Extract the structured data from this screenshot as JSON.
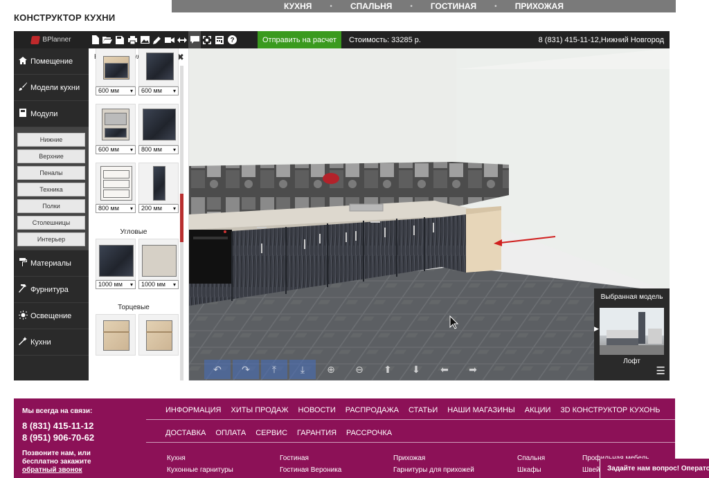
{
  "topnav": {
    "items": [
      "КУХНЯ",
      "СПАЛЬНЯ",
      "ГОСТИНАЯ",
      "ПРИХОЖАЯ"
    ]
  },
  "page": {
    "title": "КОНСТРУКТОР КУХНИ"
  },
  "appbar": {
    "logo": "BPlanner",
    "send_label": "Отправить на расчет",
    "cost_label": "Стоимость: 33285 р.",
    "contact": "8 (831) 415-11-12,Нижний Новгород",
    "tool_icons": [
      "new-file-icon",
      "open-folder-icon",
      "save-icon",
      "print-icon",
      "image-icon",
      "pencil-icon",
      "video-icon",
      "resize-icon",
      "comment-icon",
      "fullscreen-icon",
      "calculator-icon",
      "help-icon"
    ]
  },
  "sidebar": {
    "items": [
      {
        "label": "Помещение",
        "icon": "home-icon"
      },
      {
        "label": "Модели кухни",
        "icon": "brush-icon"
      },
      {
        "label": "Модули",
        "icon": "module-icon"
      },
      {
        "label": "Материалы",
        "icon": "paint-roller-icon"
      },
      {
        "label": "Фурнитура",
        "icon": "hammer-icon"
      },
      {
        "label": "Освещение",
        "icon": "light-icon"
      },
      {
        "label": "Кухни",
        "icon": "magic-icon"
      }
    ],
    "module_sub": [
      "Нижние",
      "Верхние",
      "Пеналы",
      "Техника",
      "Полки",
      "Столешницы",
      "Интерьер"
    ]
  },
  "modules_panel": {
    "title": "Нижние модули",
    "close": "✖",
    "group_corner": "Угловые",
    "group_end": "Торцевые",
    "sizes": [
      "600 мм",
      "600 мм",
      "600 мм",
      "800 мм",
      "800 мм",
      "200 мм",
      "1000 мм",
      "1000 мм"
    ]
  },
  "selected_model": {
    "title": "Выбранная модель",
    "name": "Лофт"
  },
  "footer": {
    "stay": "Мы всегда на связи:",
    "phone1": "8 (831) 415-11-12",
    "phone2": "8 (951) 906-70-62",
    "call1": "Позвоните нам, или",
    "call2": "бесплатно закажите",
    "call3": "обратный звонок",
    "nav1": [
      "ИНФОРМАЦИЯ",
      "ХИТЫ ПРОДАЖ",
      "НОВОСТИ",
      "РАСПРОДАЖА",
      "СТАТЬИ",
      "НАШИ МАГАЗИНЫ",
      "АКЦИИ",
      "3D КОНСТРУКТОР КУХОНЬ"
    ],
    "nav2": [
      "ДОСТАВКА",
      "ОПЛАТА",
      "СЕРВИС",
      "ГАРАНТИЯ",
      "РАССРОЧКА"
    ],
    "cols": [
      [
        "Кухня",
        "Кухонные гарнитуры"
      ],
      [
        "Гостиная",
        "Гостиная Вероника"
      ],
      [
        "Прихожая",
        "Гарнитуры для прихожей"
      ],
      [
        "Спальня",
        "Шкафы"
      ],
      [
        "Профильная мебель",
        "Швей"
      ]
    ],
    "chat": "Задайте нам вопрос! Операто"
  }
}
